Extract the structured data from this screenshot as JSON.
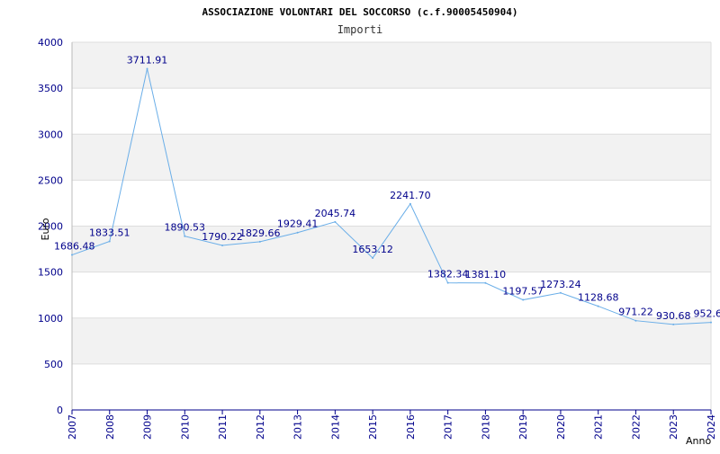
{
  "chart_data": {
    "type": "line",
    "title": "ASSOCIAZIONE VOLONTARI DEL SOCCORSO (c.f.90005450904)",
    "subtitle": "Importi",
    "xlabel": "Anno",
    "ylabel": "Euro",
    "categories": [
      "2007",
      "2008",
      "2009",
      "2010",
      "2011",
      "2012",
      "2013",
      "2014",
      "2015",
      "2016",
      "2017",
      "2018",
      "2019",
      "2020",
      "2021",
      "2022",
      "2023",
      "2024"
    ],
    "yticks": [
      "0",
      "500",
      "1000",
      "1500",
      "2000",
      "2500",
      "3000",
      "3500",
      "4000"
    ],
    "ylim": [
      0,
      4000
    ],
    "grid": "horizontal, alternating bands",
    "series": [
      {
        "values": [
          1686.48,
          1833.51,
          3711.91,
          1890.53,
          1790.22,
          1829.66,
          1929.41,
          2045.74,
          1653.12,
          2241.7,
          1382.34,
          1381.1,
          1197.57,
          1273.24,
          1128.68,
          971.22,
          930.68,
          952.6
        ],
        "labels": [
          "1686.48",
          "1833.51",
          "3711.91",
          "1890.53",
          "1790.22",
          "1829.66",
          "1929.41",
          "2045.74",
          "1653.12",
          "2241.70",
          "1382.34",
          "1381.10",
          "1197.57",
          "1273.24",
          "1128.68",
          "971.22",
          "930.68",
          "952.6"
        ]
      }
    ],
    "colors": {
      "line": "#6aaee8",
      "band": "#f2f2f2",
      "axis": "#00008b",
      "grid": "#dddddd"
    }
  }
}
